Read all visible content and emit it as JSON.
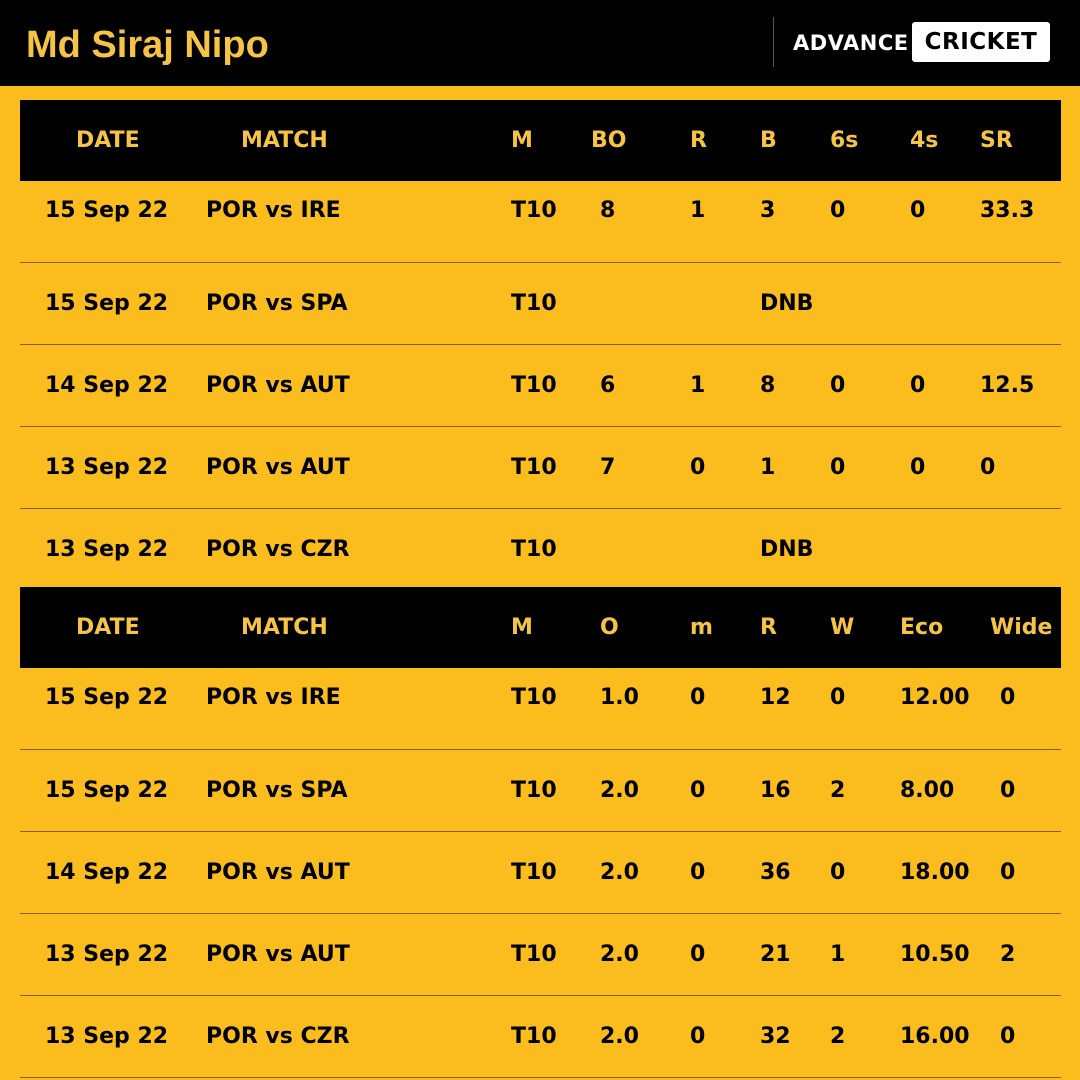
{
  "header": {
    "player_name": "Md Siraj Nipo",
    "brand_left": "ADVANCE",
    "brand_right": "CRICKET"
  },
  "batting": {
    "columns": [
      "DATE",
      "MATCH",
      "M",
      "BO",
      "R",
      "B",
      "6s",
      "4s",
      "SR"
    ],
    "rows": [
      {
        "date": "15 Sep 22",
        "match": "POR vs IRE",
        "m": "T10",
        "bo": "8",
        "r": "1",
        "b": "3",
        "sixes": "0",
        "fours": "0",
        "sr": "33.3",
        "dnb": ""
      },
      {
        "date": "15 Sep 22",
        "match": "POR vs SPA",
        "m": "T10",
        "bo": "",
        "r": "",
        "b": "",
        "sixes": "",
        "fours": "",
        "sr": "",
        "dnb": "DNB"
      },
      {
        "date": "14 Sep 22",
        "match": "POR vs AUT",
        "m": "T10",
        "bo": "6",
        "r": "1",
        "b": "8",
        "sixes": "0",
        "fours": "0",
        "sr": "12.5",
        "dnb": ""
      },
      {
        "date": "13 Sep 22",
        "match": "POR vs AUT",
        "m": "T10",
        "bo": "7",
        "r": "0",
        "b": "1",
        "sixes": "0",
        "fours": "0",
        "sr": "0",
        "dnb": ""
      },
      {
        "date": "13 Sep 22",
        "match": "POR vs CZR",
        "m": "T10",
        "bo": "",
        "r": "",
        "b": "",
        "sixes": "",
        "fours": "",
        "sr": "",
        "dnb": "DNB"
      }
    ]
  },
  "bowling": {
    "columns": [
      "DATE",
      "MATCH",
      "M",
      "O",
      "m",
      "R",
      "W",
      "Eco",
      "Wide"
    ],
    "rows": [
      {
        "date": "15 Sep 22",
        "match": "POR vs IRE",
        "m": "T10",
        "o": "1.0",
        "maidens": "0",
        "r": "12",
        "w": "0",
        "eco": "12.00",
        "wide": "0"
      },
      {
        "date": "15 Sep 22",
        "match": "POR vs SPA",
        "m": "T10",
        "o": "2.0",
        "maidens": "0",
        "r": "16",
        "w": "2",
        "eco": "8.00",
        "wide": "0"
      },
      {
        "date": "14 Sep 22",
        "match": "POR vs AUT",
        "m": "T10",
        "o": "2.0",
        "maidens": "0",
        "r": "36",
        "w": "0",
        "eco": "18.00",
        "wide": "0"
      },
      {
        "date": "13 Sep 22",
        "match": "POR vs AUT",
        "m": "T10",
        "o": "2.0",
        "maidens": "0",
        "r": "21",
        "w": "1",
        "eco": "10.50",
        "wide": "2"
      },
      {
        "date": "13 Sep 22",
        "match": "POR vs CZR",
        "m": "T10",
        "o": "2.0",
        "maidens": "0",
        "r": "32",
        "w": "2",
        "eco": "16.00",
        "wide": "0"
      }
    ]
  }
}
